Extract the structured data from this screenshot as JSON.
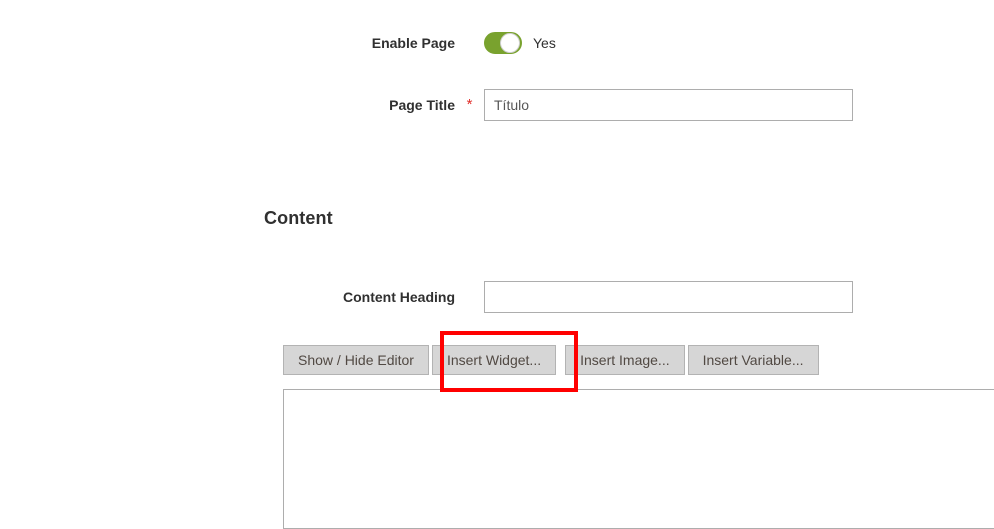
{
  "form": {
    "enable_page": {
      "label": "Enable Page",
      "toggle_state_label": "Yes",
      "toggle_on": true,
      "toggle_on_color": "#79a22e",
      "knob_color": "#ffffff"
    },
    "page_title": {
      "label": "Page Title",
      "required_marker": "*",
      "required_marker_color": "#e02b27",
      "value": "Título",
      "placeholder": "Título"
    }
  },
  "content_section": {
    "title": "Content",
    "content_heading": {
      "label": "Content Heading",
      "value": "",
      "placeholder": ""
    },
    "editor_buttons": [
      {
        "label": "Show / Hide Editor",
        "name": "show-hide-editor-button"
      },
      {
        "label": "Insert Widget...",
        "name": "insert-widget-button"
      },
      {
        "label": "Insert Image...",
        "name": "insert-image-button"
      },
      {
        "label": "Insert Variable...",
        "name": "insert-variable-button"
      }
    ],
    "editor_textarea": {
      "value": "",
      "placeholder": ""
    }
  },
  "annotation": {
    "target": "Insert Widget...",
    "color": "#ff0000",
    "stroke_width": 4
  }
}
